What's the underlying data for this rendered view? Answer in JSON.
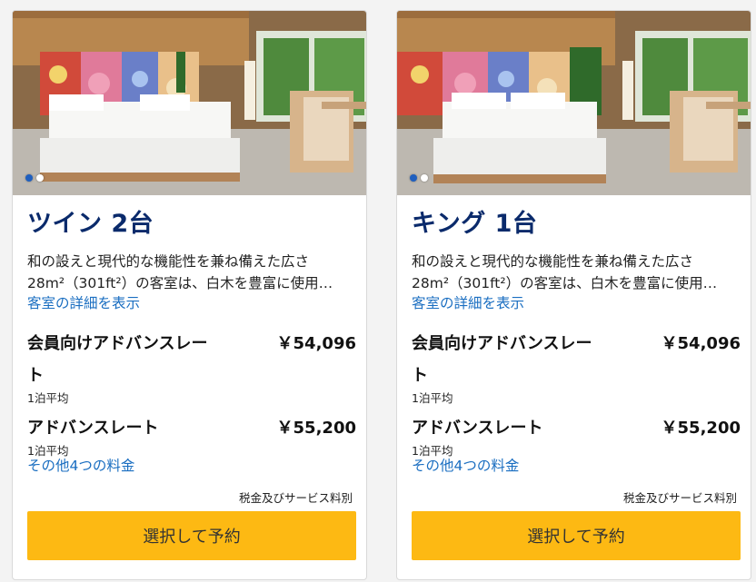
{
  "rooms": [
    {
      "title": "ツイン 2台",
      "description_line1": "和の設えと現代的な機能性を兼ね備えた広さ",
      "description_line2": "28m²（301ft²）の客室は、白木を豊富に使用…",
      "details_link": "客室の詳細を表示",
      "rates": [
        {
          "name": "会員向けアドバンスレート",
          "price": "￥54,096",
          "note": "1泊平均"
        },
        {
          "name": "アドバンスレート",
          "price": "￥55,200",
          "note": "1泊平均"
        }
      ],
      "more_rates_link": "その他4つの料金",
      "tax_note": "税金及びサービス料別",
      "select_button": "選択して予約",
      "carousel": {
        "total": 2,
        "active": 1
      }
    },
    {
      "title": "キング 1台",
      "description_line1": "和の設えと現代的な機能性を兼ね備えた広さ",
      "description_line2": "28m²（301ft²）の客室は、白木を豊富に使用…",
      "details_link": "客室の詳細を表示",
      "rates": [
        {
          "name": "会員向けアドバンスレート",
          "price": "￥54,096",
          "note": "1泊平均"
        },
        {
          "name": "アドバンスレート",
          "price": "￥55,200",
          "note": "1泊平均"
        }
      ],
      "more_rates_link": "その他4つの料金",
      "tax_note": "税金及びサービス料別",
      "select_button": "選択して予約",
      "carousel": {
        "total": 2,
        "active": 1
      }
    }
  ],
  "colors": {
    "title": "#0a2a6b",
    "link": "#1a6ec1",
    "button": "#fdb913",
    "active_dot": "#1f5fbf"
  }
}
